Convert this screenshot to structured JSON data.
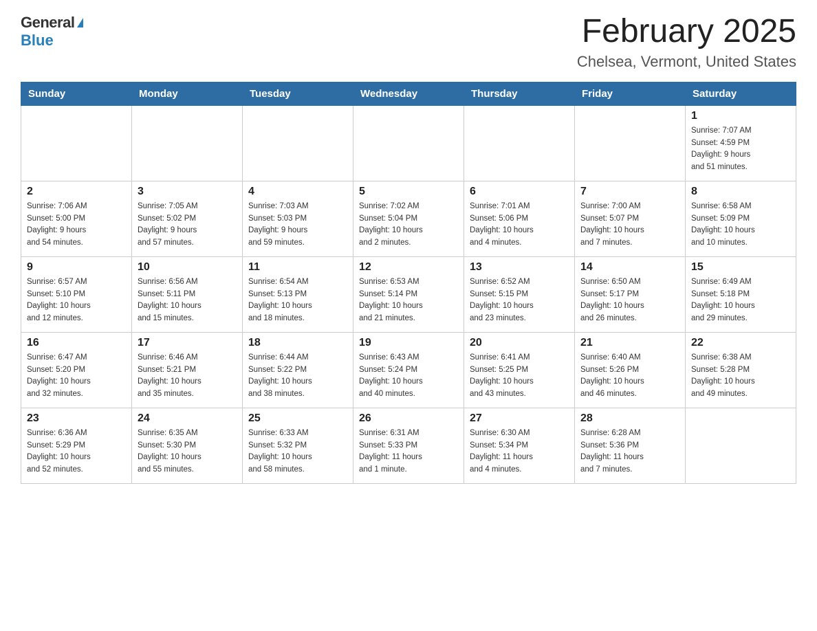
{
  "logo": {
    "general": "General",
    "blue": "Blue"
  },
  "title": "February 2025",
  "subtitle": "Chelsea, Vermont, United States",
  "days_of_week": [
    "Sunday",
    "Monday",
    "Tuesday",
    "Wednesday",
    "Thursday",
    "Friday",
    "Saturday"
  ],
  "weeks": [
    [
      {
        "day": "",
        "info": "",
        "empty": true
      },
      {
        "day": "",
        "info": "",
        "empty": true
      },
      {
        "day": "",
        "info": "",
        "empty": true
      },
      {
        "day": "",
        "info": "",
        "empty": true
      },
      {
        "day": "",
        "info": "",
        "empty": true
      },
      {
        "day": "",
        "info": "",
        "empty": true
      },
      {
        "day": "1",
        "info": "Sunrise: 7:07 AM\nSunset: 4:59 PM\nDaylight: 9 hours\nand 51 minutes."
      }
    ],
    [
      {
        "day": "2",
        "info": "Sunrise: 7:06 AM\nSunset: 5:00 PM\nDaylight: 9 hours\nand 54 minutes."
      },
      {
        "day": "3",
        "info": "Sunrise: 7:05 AM\nSunset: 5:02 PM\nDaylight: 9 hours\nand 57 minutes."
      },
      {
        "day": "4",
        "info": "Sunrise: 7:03 AM\nSunset: 5:03 PM\nDaylight: 9 hours\nand 59 minutes."
      },
      {
        "day": "5",
        "info": "Sunrise: 7:02 AM\nSunset: 5:04 PM\nDaylight: 10 hours\nand 2 minutes."
      },
      {
        "day": "6",
        "info": "Sunrise: 7:01 AM\nSunset: 5:06 PM\nDaylight: 10 hours\nand 4 minutes."
      },
      {
        "day": "7",
        "info": "Sunrise: 7:00 AM\nSunset: 5:07 PM\nDaylight: 10 hours\nand 7 minutes."
      },
      {
        "day": "8",
        "info": "Sunrise: 6:58 AM\nSunset: 5:09 PM\nDaylight: 10 hours\nand 10 minutes."
      }
    ],
    [
      {
        "day": "9",
        "info": "Sunrise: 6:57 AM\nSunset: 5:10 PM\nDaylight: 10 hours\nand 12 minutes."
      },
      {
        "day": "10",
        "info": "Sunrise: 6:56 AM\nSunset: 5:11 PM\nDaylight: 10 hours\nand 15 minutes."
      },
      {
        "day": "11",
        "info": "Sunrise: 6:54 AM\nSunset: 5:13 PM\nDaylight: 10 hours\nand 18 minutes."
      },
      {
        "day": "12",
        "info": "Sunrise: 6:53 AM\nSunset: 5:14 PM\nDaylight: 10 hours\nand 21 minutes."
      },
      {
        "day": "13",
        "info": "Sunrise: 6:52 AM\nSunset: 5:15 PM\nDaylight: 10 hours\nand 23 minutes."
      },
      {
        "day": "14",
        "info": "Sunrise: 6:50 AM\nSunset: 5:17 PM\nDaylight: 10 hours\nand 26 minutes."
      },
      {
        "day": "15",
        "info": "Sunrise: 6:49 AM\nSunset: 5:18 PM\nDaylight: 10 hours\nand 29 minutes."
      }
    ],
    [
      {
        "day": "16",
        "info": "Sunrise: 6:47 AM\nSunset: 5:20 PM\nDaylight: 10 hours\nand 32 minutes."
      },
      {
        "day": "17",
        "info": "Sunrise: 6:46 AM\nSunset: 5:21 PM\nDaylight: 10 hours\nand 35 minutes."
      },
      {
        "day": "18",
        "info": "Sunrise: 6:44 AM\nSunset: 5:22 PM\nDaylight: 10 hours\nand 38 minutes."
      },
      {
        "day": "19",
        "info": "Sunrise: 6:43 AM\nSunset: 5:24 PM\nDaylight: 10 hours\nand 40 minutes."
      },
      {
        "day": "20",
        "info": "Sunrise: 6:41 AM\nSunset: 5:25 PM\nDaylight: 10 hours\nand 43 minutes."
      },
      {
        "day": "21",
        "info": "Sunrise: 6:40 AM\nSunset: 5:26 PM\nDaylight: 10 hours\nand 46 minutes."
      },
      {
        "day": "22",
        "info": "Sunrise: 6:38 AM\nSunset: 5:28 PM\nDaylight: 10 hours\nand 49 minutes."
      }
    ],
    [
      {
        "day": "23",
        "info": "Sunrise: 6:36 AM\nSunset: 5:29 PM\nDaylight: 10 hours\nand 52 minutes."
      },
      {
        "day": "24",
        "info": "Sunrise: 6:35 AM\nSunset: 5:30 PM\nDaylight: 10 hours\nand 55 minutes."
      },
      {
        "day": "25",
        "info": "Sunrise: 6:33 AM\nSunset: 5:32 PM\nDaylight: 10 hours\nand 58 minutes."
      },
      {
        "day": "26",
        "info": "Sunrise: 6:31 AM\nSunset: 5:33 PM\nDaylight: 11 hours\nand 1 minute."
      },
      {
        "day": "27",
        "info": "Sunrise: 6:30 AM\nSunset: 5:34 PM\nDaylight: 11 hours\nand 4 minutes."
      },
      {
        "day": "28",
        "info": "Sunrise: 6:28 AM\nSunset: 5:36 PM\nDaylight: 11 hours\nand 7 minutes."
      },
      {
        "day": "",
        "info": "",
        "empty": true
      }
    ]
  ]
}
